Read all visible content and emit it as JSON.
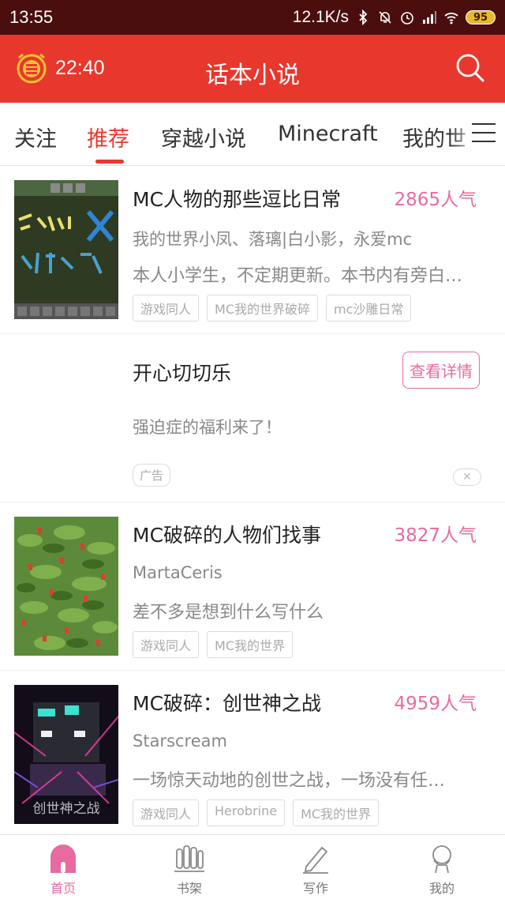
{
  "status_bar": {
    "time": "13:55",
    "speed": "12.1K/s",
    "battery": "95"
  },
  "header": {
    "timer": "22:40",
    "title": "话本小说"
  },
  "tabs": [
    {
      "label": "关注",
      "active": false
    },
    {
      "label": "推荐",
      "active": true
    },
    {
      "label": "穿越小说",
      "active": false
    },
    {
      "label": "Minecraft",
      "active": false
    },
    {
      "label": "我的世",
      "active": false
    }
  ],
  "feed": {
    "book1": {
      "title": "MC人物的那些逗比日常",
      "popularity": "2865人气",
      "author": "我的世界小凤、落璃|白小影，永爱mc",
      "description": "本人小学生，不定期更新。本书内有旁白…",
      "tags": [
        "游戏同人",
        "MC我的世界破碎",
        "mc沙雕日常"
      ]
    },
    "ad": {
      "title": "开心切切乐",
      "button": "查看详情",
      "description": "强迫症的福利来了！",
      "badge": "广告"
    },
    "book2": {
      "title": "MC破碎的人物们找事",
      "popularity": "3827人气",
      "author": "MartaCeris",
      "description": "差不多是想到什么写什么",
      "tags": [
        "游戏同人",
        "MC我的世界"
      ]
    },
    "book3": {
      "title": "MC破碎：创世神之战",
      "popularity": "4959人气",
      "author": "Starscream",
      "description": "一场惊天动地的创世之战，一场没有任…",
      "cover_text": "创世神之战",
      "tags": [
        "游戏同人",
        "Herobrine",
        "MC我的世界"
      ]
    }
  },
  "bottom_nav": [
    {
      "label": "首页",
      "icon": "home-icon",
      "active": true
    },
    {
      "label": "书架",
      "icon": "bookshelf-icon",
      "active": false
    },
    {
      "label": "写作",
      "icon": "pen-icon",
      "active": false
    },
    {
      "label": "我的",
      "icon": "profile-icon",
      "active": false
    }
  ],
  "colors": {
    "brand_red": "#e8372c",
    "accent_pink": "#e86aa0",
    "status_bar": "#4a0e0e"
  }
}
